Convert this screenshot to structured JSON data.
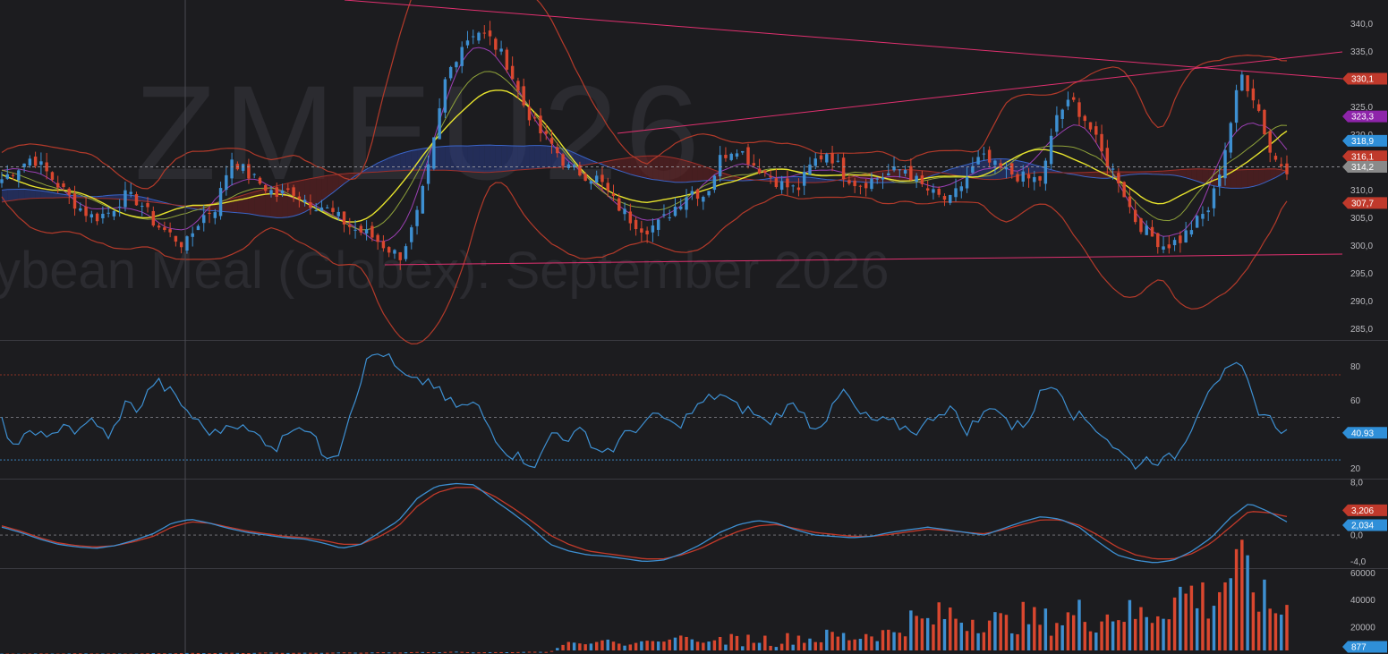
{
  "watermark": {
    "symbol": "ZMEU26",
    "name": "ybean Meal (Globex): September 2026"
  },
  "colors": {
    "background": "#1c1c1f",
    "up": "#3d8fd1",
    "down": "#d9472f",
    "trendline": "#e0306f",
    "rsi": "#3d8fd1",
    "macd": "#3d8fd1",
    "signal": "#c23a2a",
    "ma_fast": "#e7e32d",
    "ma_mid": "#8fa23a",
    "bollinger": "#b33a2a",
    "cloud_bull": "#2a3d86",
    "cloud_bear": "#6b2020"
  },
  "chart_data": [
    {
      "panel": "price",
      "type": "candlestick",
      "ylim": [
        283,
        343
      ],
      "ticks": [
        "340,0",
        "335,0",
        "330,0",
        "325,0",
        "320,0",
        "315,0",
        "310,0",
        "305,0",
        "300,0",
        "295,0",
        "290,0",
        "285,0"
      ],
      "close_path": [
        312,
        314,
        316,
        313,
        310,
        307,
        305,
        306,
        309,
        308,
        304,
        302,
        300,
        305,
        307,
        316,
        313,
        311,
        309,
        310,
        308,
        307,
        305,
        303,
        302,
        300,
        298,
        304,
        315,
        330,
        336,
        339,
        337,
        333,
        326,
        321,
        318,
        314,
        313,
        312,
        308,
        305,
        303,
        304,
        307,
        310,
        309,
        316,
        318,
        315,
        313,
        311,
        310,
        315,
        317,
        313,
        311,
        312,
        313,
        314,
        311,
        309,
        308,
        312,
        316,
        314,
        313,
        312,
        312,
        324,
        326,
        322,
        316,
        312,
        305,
        302,
        300,
        301,
        304,
        307,
        318,
        331,
        326,
        316,
        314
      ],
      "labels": [
        {
          "text": "330,1",
          "value": 330.1,
          "color": "#c0392b"
        },
        {
          "text": "323,3",
          "value": 323.3,
          "color": "#8e24aa"
        },
        {
          "text": "318,9",
          "value": 318.9,
          "color": "#2f8fd8"
        },
        {
          "text": "316,1",
          "value": 316.1,
          "color": "#c0392b"
        },
        {
          "text": "314,2",
          "value": 314.2,
          "color": "#8a8a8a"
        },
        {
          "text": "307,7",
          "value": 307.7,
          "color": "#c0392b"
        }
      ]
    },
    {
      "panel": "rsi",
      "type": "line",
      "ylim": [
        14,
        95
      ],
      "ticks": [
        "80",
        "60",
        "40",
        "20"
      ],
      "levels": [
        75,
        50,
        25
      ],
      "values": [
        47,
        30,
        45,
        35,
        48,
        40,
        50,
        36,
        58,
        55,
        72,
        65,
        55,
        45,
        40,
        48,
        42,
        38,
        32,
        46,
        44,
        28,
        30,
        60,
        86,
        88,
        76,
        70,
        72,
        60,
        56,
        58,
        42,
        30,
        26,
        22,
        42,
        38,
        42,
        30,
        32,
        42,
        46,
        52,
        44,
        52,
        60,
        64,
        56,
        54,
        46,
        54,
        58,
        44,
        50,
        66,
        52,
        48,
        47,
        44,
        42,
        52,
        56,
        42,
        50,
        58,
        44,
        47,
        66,
        70,
        52,
        48,
        40,
        30,
        22,
        26,
        24,
        30,
        50,
        70,
        76,
        80,
        56,
        48,
        41
      ],
      "label": {
        "text": "40.93",
        "value": 40.93,
        "color": "#2f8fd8"
      }
    },
    {
      "panel": "macd",
      "type": "line",
      "ylim": [
        -5,
        8.4
      ],
      "ticks": [
        "8,0",
        "4,0",
        "0,0",
        "-4,0"
      ],
      "macd": [
        1.2,
        0.4,
        -0.6,
        -1.4,
        -1.8,
        -2.0,
        -1.6,
        -0.8,
        0.2,
        1.8,
        2.4,
        1.8,
        1.0,
        0.4,
        0,
        -0.4,
        -0.6,
        -1.2,
        -2.0,
        -1.4,
        0.4,
        2.2,
        5.6,
        7.4,
        7.8,
        7.6,
        5.4,
        3.4,
        1.2,
        -1.4,
        -2.4,
        -3.0,
        -3.2,
        -3.6,
        -4.0,
        -3.8,
        -2.8,
        -1.4,
        0.4,
        1.6,
        2.2,
        1.8,
        0.8,
        0,
        -0.2,
        -0.4,
        -0.2,
        0.4,
        0.8,
        1.2,
        0.8,
        0.4,
        0,
        1.0,
        2.0,
        2.8,
        2.4,
        1.2,
        -1.0,
        -3.0,
        -3.8,
        -4.2,
        -3.8,
        -2.4,
        -0.4,
        2.6,
        4.8,
        3.6,
        2.0
      ],
      "signal": [
        1.4,
        0.6,
        -0.4,
        -1.2,
        -1.6,
        -1.8,
        -1.6,
        -1.0,
        -0.2,
        1.2,
        2.0,
        1.8,
        1.2,
        0.6,
        0.2,
        -0.2,
        -0.4,
        -0.8,
        -1.4,
        -1.4,
        -0.2,
        1.4,
        4.4,
        6.4,
        7.2,
        7.2,
        6.0,
        4.2,
        2.2,
        0,
        -1.4,
        -2.4,
        -2.8,
        -3.2,
        -3.6,
        -3.6,
        -3.0,
        -2.0,
        -0.6,
        0.6,
        1.4,
        1.6,
        1.0,
        0.4,
        0.1,
        -0.2,
        -0.2,
        0.1,
        0.5,
        0.9,
        0.7,
        0.4,
        0.2,
        0.8,
        1.6,
        2.3,
        2.3,
        1.5,
        0,
        -1.8,
        -3.0,
        -3.6,
        -3.6,
        -2.8,
        -1.2,
        1.2,
        3.6,
        3.4,
        2.8
      ],
      "labels": [
        {
          "text": "3,206",
          "value": 3.206,
          "color": "#c0392b"
        },
        {
          "text": "2,034",
          "value": 2.034,
          "color": "#2f8fd8"
        }
      ]
    },
    {
      "panel": "volume",
      "type": "bar",
      "ylim": [
        0,
        63000
      ],
      "ticks": [
        "60000",
        "40000",
        "20000"
      ],
      "values": [
        300,
        200,
        400,
        250,
        500,
        300,
        350,
        200,
        600,
        400,
        800,
        500,
        900,
        600,
        1100,
        700,
        900,
        800,
        1200,
        900,
        1300,
        1000,
        1500,
        1200,
        1800,
        1100,
        1400,
        1300,
        1700,
        1500,
        9000,
        7000,
        11000,
        6000,
        10000,
        9000,
        14000,
        8000,
        11000,
        10000,
        12000,
        9000,
        13000,
        11000,
        14000,
        12000,
        16000,
        15000,
        25000,
        23000,
        30000,
        26000,
        28000,
        22000,
        27000,
        24000,
        25000,
        30000,
        26000,
        32000,
        28000,
        31000,
        42000,
        46000,
        38000,
        62000,
        57000,
        34000,
        33000
      ],
      "label": {
        "text": "877",
        "value": 877,
        "color": "#2f8fd8"
      }
    }
  ]
}
